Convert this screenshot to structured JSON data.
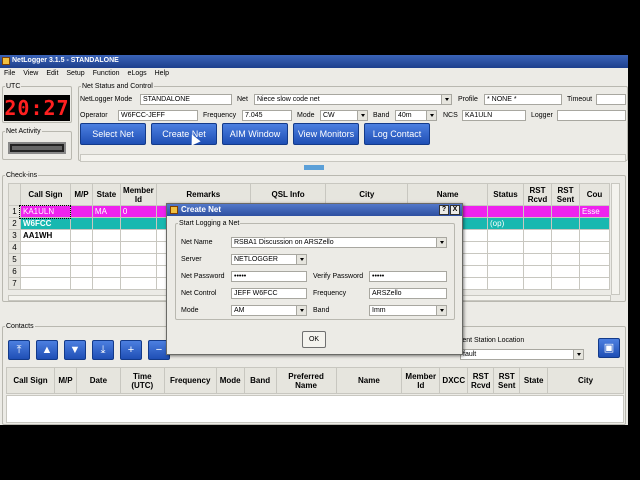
{
  "app": {
    "title": "NetLogger 3.1.5 - STANDALONE"
  },
  "menu": [
    "File",
    "View",
    "Edit",
    "Setup",
    "Function",
    "eLogs",
    "Help"
  ],
  "utc": {
    "label": "UTC",
    "time": "20:27"
  },
  "net_activity": {
    "label": "Net Activity"
  },
  "status": {
    "group_label": "Net Status and Control",
    "mode_label": "NetLogger Mode",
    "mode_value": "STANDALONE",
    "net_label": "Net",
    "net_value": "Niece  slow code net",
    "profile_label": "Profile",
    "profile_value": "* NONE *",
    "timeout_label": "Timeout",
    "operator_label": "Operator",
    "operator_value": "W6FCC-JEFF",
    "frequency_label": "Frequency",
    "frequency_value": "7.045",
    "mode2_label": "Mode",
    "mode2_value": "CW",
    "band_label": "Band",
    "band_value": "40m",
    "ncs_label": "NCS",
    "ncs_value": "KA1ULN",
    "logger_label": "Logger"
  },
  "buttons": {
    "select_net": "Select Net",
    "create_net": "Create Net",
    "aim_window": "AIM Window",
    "view_monitors": "View Monitors",
    "log_contact": "Log Contact"
  },
  "checkins": {
    "label": "Check-ins",
    "headers": [
      "",
      "Call Sign",
      "M/P",
      "State",
      "Member Id",
      "Remarks",
      "QSL Info",
      "City",
      "Name",
      "Status",
      "RST Rcvd",
      "RST Sent",
      "Cou"
    ],
    "rows": [
      [
        "1",
        "KA1ULN",
        "",
        "MA",
        "0",
        "",
        "",
        "",
        "",
        "",
        "",
        "",
        "Esse"
      ],
      [
        "2",
        "W6FCC",
        "",
        "",
        "",
        "",
        "",
        "",
        "",
        "(op)",
        "",
        "",
        ""
      ],
      [
        "3",
        "AA1WH",
        "",
        "",
        "",
        "",
        "",
        "",
        "",
        "",
        "",
        "",
        ""
      ],
      [
        "4",
        "",
        "",
        "",
        "",
        "",
        "",
        "",
        "",
        "",
        "",
        "",
        ""
      ],
      [
        "5",
        "",
        "",
        "",
        "",
        "",
        "",
        "",
        "",
        "",
        "",
        "",
        ""
      ],
      [
        "6",
        "",
        "",
        "",
        "",
        "",
        "",
        "",
        "",
        "",
        "",
        "",
        ""
      ],
      [
        "7",
        "",
        "",
        "",
        "",
        "",
        "",
        "",
        "",
        "",
        "",
        "",
        ""
      ]
    ]
  },
  "contacts": {
    "label": "Contacts",
    "location_label": "rent Station Location",
    "location_value": "fault",
    "headers": [
      "Call Sign",
      "M/P",
      "Date",
      "Time (UTC)",
      "Frequency",
      "Mode",
      "Band",
      "Preferred Name",
      "Name",
      "Member Id",
      "DXCC",
      "RST Rcvd",
      "RST Sent",
      "State",
      "City"
    ]
  },
  "dialog": {
    "title": "Create Net",
    "group_label": "Start Logging a Net",
    "net_name_label": "Net Name",
    "net_name_value": "RSBA1 Discussion on ARSZello",
    "server_label": "Server",
    "server_value": "NETLOGGER",
    "net_password_label": "Net Password",
    "net_password_value": "•••••",
    "verify_password_label": "Verify Password",
    "verify_password_value": "•••••",
    "net_control_label": "Net Control",
    "net_control_value": "JEFF W6FCC",
    "frequency_label": "Frequency",
    "frequency_value": "ARSZello",
    "mode_label": "Mode",
    "mode_value": "AM",
    "band_label": "Band",
    "band_value": "Imm",
    "ok_label": "OK",
    "help_label": "?",
    "close_label": "X"
  }
}
